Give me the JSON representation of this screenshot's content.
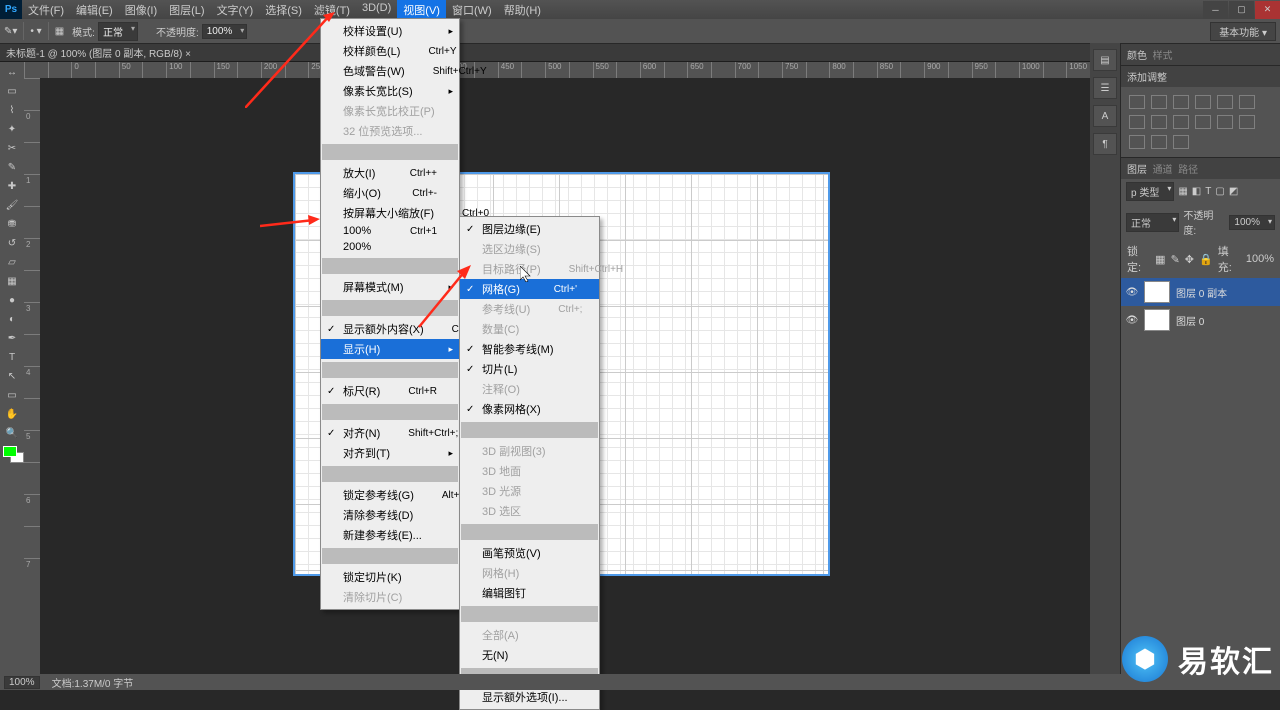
{
  "app": {
    "logo": "Ps"
  },
  "menus": [
    "文件(F)",
    "编辑(E)",
    "图像(I)",
    "图层(L)",
    "文字(Y)",
    "选择(S)",
    "滤镜(T)",
    "3D(D)",
    "视图(V)",
    "窗口(W)",
    "帮助(H)"
  ],
  "activeMenuIndex": 8,
  "options": {
    "modeLabel": "模式:",
    "modeValue": "正常",
    "opacityLabel": "不透明度:",
    "opacityValue": "100%",
    "expand": "基本功能 ▾"
  },
  "doc": {
    "tab": "未标题-1 @ 100% (图层 0 副本, RGB/8) ×"
  },
  "rulerH": [
    "",
    "",
    "0",
    "",
    "50",
    "",
    "100",
    "",
    "150",
    "",
    "200",
    "",
    "250",
    "",
    "300",
    "",
    "350",
    "",
    "400",
    "",
    "450",
    "",
    "500",
    "",
    "550",
    "",
    "600",
    "",
    "650",
    "",
    "700",
    "",
    "750",
    "",
    "800",
    "",
    "850",
    "",
    "900",
    "",
    "950",
    "",
    "1000",
    "",
    "1050"
  ],
  "rulerV": [
    "",
    "0",
    "",
    "1",
    "",
    "2",
    "",
    "3",
    "",
    "4",
    "",
    "5",
    "",
    "6",
    "",
    "7"
  ],
  "viewMenu": {
    "items": [
      {
        "t": "校样设置(U)",
        "arrow": true
      },
      {
        "t": "校样颜色(L)",
        "sc": "Ctrl+Y"
      },
      {
        "t": "色域警告(W)",
        "sc": "Shift+Ctrl+Y"
      },
      {
        "t": "像素长宽比(S)",
        "arrow": true
      },
      {
        "t": "像素长宽比校正(P)",
        "disabled": true
      },
      {
        "t": "32 位预览选项...",
        "disabled": true
      },
      {
        "sep": true
      },
      {
        "t": "放大(I)",
        "sc": "Ctrl++"
      },
      {
        "t": "缩小(O)",
        "sc": "Ctrl+-"
      },
      {
        "t": "按屏幕大小缩放(F)",
        "sc": "Ctrl+0"
      },
      {
        "t": "100%",
        "sc": "Ctrl+1"
      },
      {
        "t": "200%"
      },
      {
        "sep": true
      },
      {
        "t": "屏幕模式(M)",
        "arrow": true
      },
      {
        "sep": true
      },
      {
        "t": "显示额外内容(X)",
        "sc": "Ctrl+H",
        "check": true
      },
      {
        "t": "显示(H)",
        "arrow": true,
        "highlight": true
      },
      {
        "sep": true
      },
      {
        "t": "标尺(R)",
        "sc": "Ctrl+R",
        "check": true
      },
      {
        "sep": true
      },
      {
        "t": "对齐(N)",
        "sc": "Shift+Ctrl+;",
        "check": true
      },
      {
        "t": "对齐到(T)",
        "arrow": true
      },
      {
        "sep": true
      },
      {
        "t": "锁定参考线(G)",
        "sc": "Alt+Ctrl+;"
      },
      {
        "t": "清除参考线(D)"
      },
      {
        "t": "新建参考线(E)..."
      },
      {
        "sep": true
      },
      {
        "t": "锁定切片(K)"
      },
      {
        "t": "清除切片(C)",
        "disabled": true
      }
    ]
  },
  "showMenu": {
    "items": [
      {
        "t": "图层边缘(E)",
        "check": true
      },
      {
        "t": "选区边缘(S)",
        "disabled": true
      },
      {
        "t": "目标路径(P)",
        "sc": "Shift+Ctrl+H",
        "disabled": true
      },
      {
        "t": "网格(G)",
        "sc": "Ctrl+'",
        "check": true,
        "highlight": true
      },
      {
        "t": "参考线(U)",
        "sc": "Ctrl+;",
        "disabled": true
      },
      {
        "t": "数量(C)",
        "disabled": true
      },
      {
        "t": "智能参考线(M)",
        "check": true
      },
      {
        "t": "切片(L)",
        "check": true
      },
      {
        "t": "注释(O)",
        "disabled": true
      },
      {
        "t": "像素网格(X)",
        "check": true
      },
      {
        "sep": true
      },
      {
        "t": "3D 副视图(3)",
        "disabled": true
      },
      {
        "t": "3D 地面",
        "disabled": true
      },
      {
        "t": "3D 光源",
        "disabled": true
      },
      {
        "t": "3D 选区",
        "disabled": true
      },
      {
        "sep": true
      },
      {
        "t": "画笔预览(V)"
      },
      {
        "t": "网格(H)",
        "disabled": true
      },
      {
        "t": "编辑图钉"
      },
      {
        "sep": true
      },
      {
        "t": "全部(A)",
        "disabled": true
      },
      {
        "t": "无(N)"
      },
      {
        "sep": true
      },
      {
        "t": "显示额外选项(I)..."
      }
    ]
  },
  "rightPanels": {
    "tabs1": [
      "颜色",
      "样式"
    ],
    "tab2": "添加调整",
    "tabs3": [
      "图层",
      "通道",
      "路径"
    ],
    "blend": "正常",
    "opacityLabel": "不透明度:",
    "opacity": "100%",
    "lockLabel": "锁定:",
    "fillLabel": "填充:",
    "fill": "100%",
    "filterLabel": "p 类型",
    "layers": [
      {
        "name": "图层 0 副本",
        "sel": true
      },
      {
        "name": "图层 0"
      }
    ]
  },
  "status": {
    "zoom": "100%",
    "doc": "文档:1.37M/0 字节"
  },
  "watermark": {
    "text": "易软汇"
  }
}
